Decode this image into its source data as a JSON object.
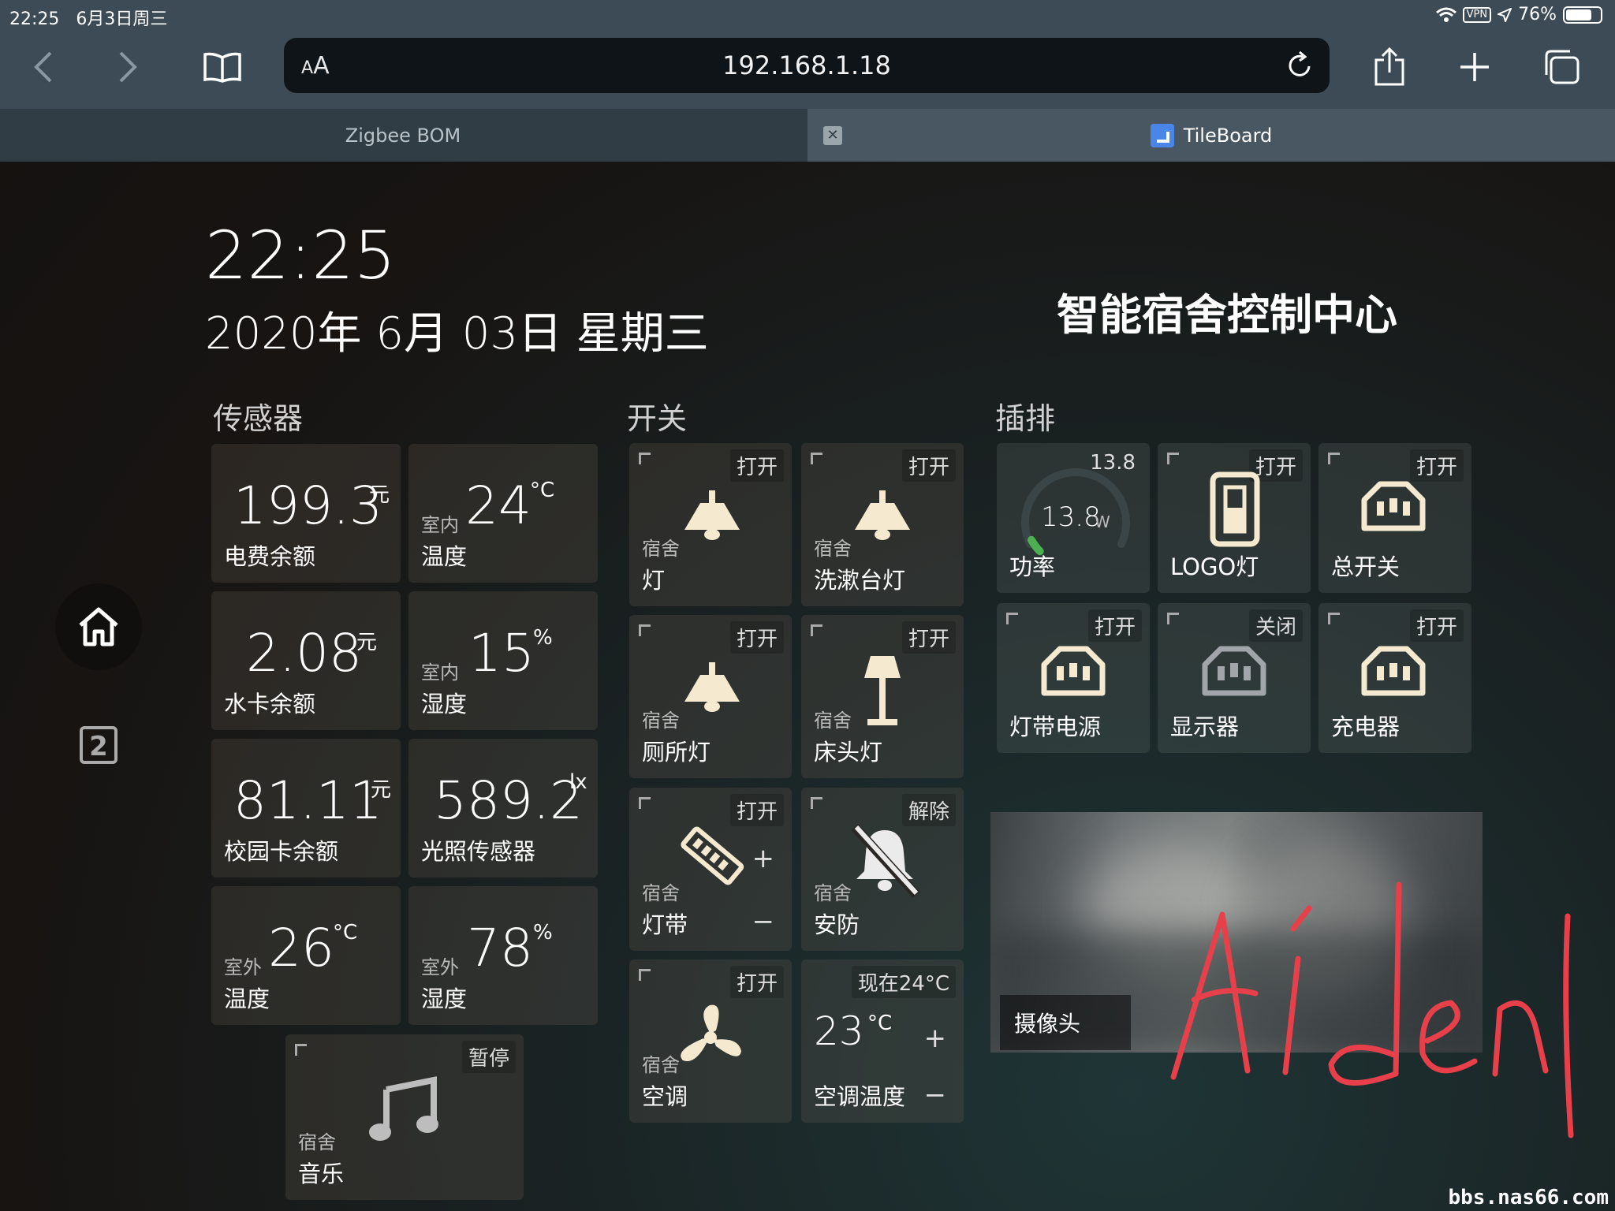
{
  "status_bar": {
    "time": "22:25",
    "date": "6月3日周三",
    "vpn": "VPN",
    "battery": "76%",
    "battery_level": 0.76
  },
  "browser": {
    "url": "192.168.1.18",
    "aa_small": "A",
    "aa_large": "A",
    "tabs": [
      {
        "label": "Zigbee BOM"
      },
      {
        "label": "TileBoard"
      }
    ],
    "tab_close": "✕"
  },
  "dashboard": {
    "time": "22:25",
    "date": "2020年 6月 03日 星期三",
    "title": "智能宿舍控制中心",
    "sidebar_page2": "2",
    "sections": {
      "sensors": "传感器",
      "switches": "开关",
      "power_strip": "插排"
    },
    "sensors": [
      {
        "value": "199.3",
        "unit": "元",
        "sub": "",
        "title": "电费余额"
      },
      {
        "value": "24",
        "unit": "°C",
        "sub": "室内",
        "title": "温度"
      },
      {
        "value": "2.08",
        "unit": "元",
        "sub": "",
        "title": "水卡余额"
      },
      {
        "value": "15",
        "unit": "%",
        "sub": "室内",
        "title": "湿度"
      },
      {
        "value": "81.11",
        "unit": "元",
        "sub": "",
        "title": "校园卡余额"
      },
      {
        "value": "589.2",
        "unit": "lx",
        "sub": "",
        "title": "光照传感器"
      },
      {
        "value": "26",
        "unit": "°C",
        "sub": "室外",
        "title": "温度"
      },
      {
        "value": "78",
        "unit": "%",
        "sub": "室外",
        "title": "湿度"
      }
    ],
    "music": {
      "state": "暂停",
      "sub": "宿舍",
      "title": "音乐"
    },
    "switches": [
      {
        "state": "打开",
        "sub": "宿舍",
        "title": "灯"
      },
      {
        "state": "打开",
        "sub": "宿舍",
        "title": "洗漱台灯"
      },
      {
        "state": "打开",
        "sub": "宿舍",
        "title": "厕所灯"
      },
      {
        "state": "打开",
        "sub": "宿舍",
        "title": "床头灯"
      },
      {
        "state": "打开",
        "sub": "宿舍",
        "title": "灯带",
        "plus": "+",
        "minus": "−"
      },
      {
        "state": "解除",
        "sub": "宿舍",
        "title": "安防"
      },
      {
        "state": "打开",
        "sub": "宿舍",
        "title": "空调"
      },
      {
        "state": "现在24°C",
        "value": "23",
        "unit": "°C",
        "title": "空调温度",
        "plus": "+",
        "minus": "−"
      }
    ],
    "power": {
      "top": "13.8",
      "value": "13.8",
      "unit": "W",
      "title": "功率",
      "gauge_fraction": 0.06
    },
    "outlets": [
      {
        "state": "打开",
        "title": "LOGO灯"
      },
      {
        "state": "打开",
        "title": "总开关"
      },
      {
        "state": "打开",
        "title": "灯带电源"
      },
      {
        "state": "关闭",
        "title": "显示器"
      },
      {
        "state": "打开",
        "title": "充电器"
      }
    ],
    "camera": {
      "label": "摄像头"
    },
    "watermark": "bbs.nas66.com"
  },
  "colors": {
    "icon_on": "#f5ead0",
    "icon_off": "#9fa5a8",
    "signature": "#e8404a"
  }
}
